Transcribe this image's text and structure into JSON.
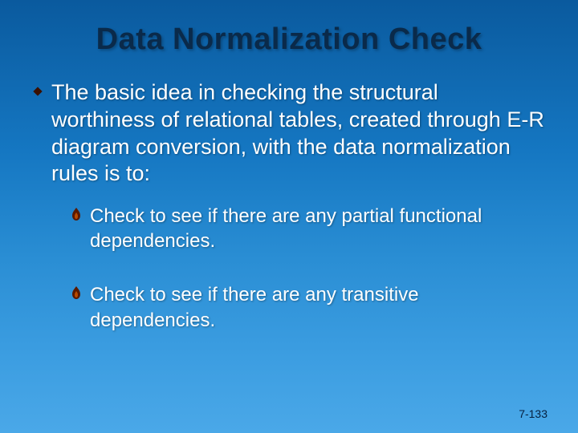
{
  "title": "Data Normalization Check",
  "main_text": "The basic idea in checking the structural worthiness of relational tables, created through E-R diagram conversion, with the data normalization rules is to:",
  "sub_items": [
    "Check to see if there are any partial functional dependencies.",
    "Check to see if there are any transitive dependencies."
  ],
  "footer": "7-133"
}
